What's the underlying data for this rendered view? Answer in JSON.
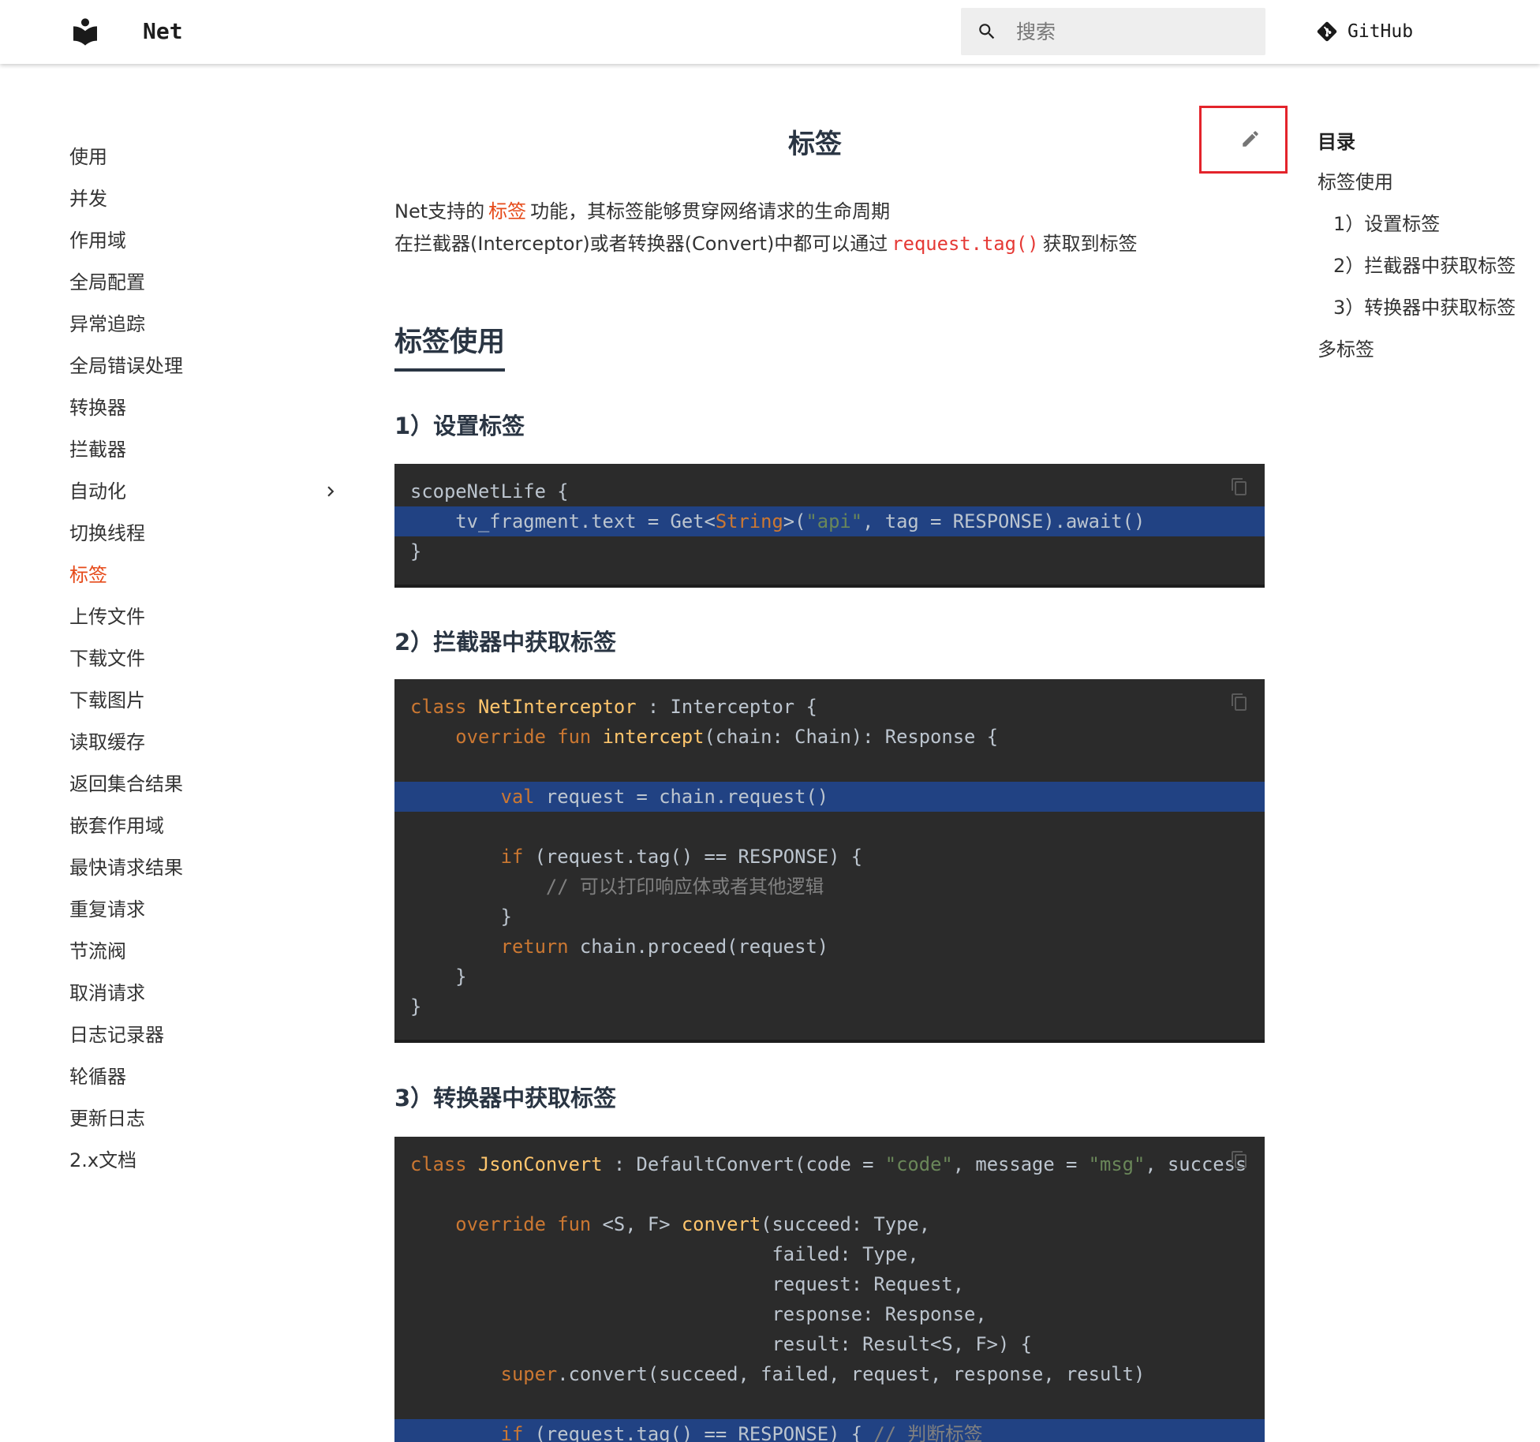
{
  "colors": {
    "accent": "#e64a19",
    "inline_code": "#e53935",
    "text": "#333333",
    "heading": "#2a3543",
    "code_bg": "#2b2b2b",
    "code_highlight": "#214283",
    "code_text": "#bcc5cf",
    "code_keyword": "#cc7832",
    "code_function": "#ffc66d",
    "code_string": "#6a8759",
    "code_comment": "#808080",
    "annotation_frame": "#e3242b"
  },
  "header": {
    "logo_icon": "book-reader-icon",
    "site_name": "Net",
    "search": {
      "icon": "search-icon",
      "placeholder": "搜索"
    },
    "github": {
      "icon": "git-icon",
      "label": "GitHub"
    }
  },
  "sidebar": {
    "items": [
      {
        "label": "使用"
      },
      {
        "label": "并发"
      },
      {
        "label": "作用域"
      },
      {
        "label": "全局配置"
      },
      {
        "label": "异常追踪"
      },
      {
        "label": "全局错误处理"
      },
      {
        "label": "转换器"
      },
      {
        "label": "拦截器"
      },
      {
        "label": "自动化",
        "expandable": true,
        "icon": "chevron-right-icon"
      },
      {
        "label": "切换线程"
      },
      {
        "label": "标签",
        "active": true
      },
      {
        "label": "上传文件"
      },
      {
        "label": "下载文件"
      },
      {
        "label": "下载图片"
      },
      {
        "label": "读取缓存"
      },
      {
        "label": "返回集合结果"
      },
      {
        "label": "嵌套作用域"
      },
      {
        "label": "最快请求结果"
      },
      {
        "label": "重复请求"
      },
      {
        "label": "节流阀"
      },
      {
        "label": "取消请求"
      },
      {
        "label": "日志记录器"
      },
      {
        "label": "轮循器"
      },
      {
        "label": "更新日志"
      },
      {
        "label": "2.x文档"
      }
    ]
  },
  "main": {
    "title": "标签",
    "edit_icon": "edit-icon",
    "intro": {
      "line1_before": "Net支持的",
      "line1_link": "标签",
      "line1_after": "功能，其标签能够贯穿网络请求的生命周期",
      "line2_before": "在拦截器(Interceptor)或者转换器(Convert)中都可以通过",
      "line2_code": "request.tag()",
      "line2_after": "获取到标签"
    },
    "section_heading": "标签使用",
    "copy_icon": "copy-icon",
    "subsections": [
      {
        "heading": "1）设置标签",
        "code": [
          {
            "tokens": [
              [
                "t",
                "scopeNetLife {"
              ]
            ]
          },
          {
            "highlight": true,
            "tokens": [
              [
                "t",
                "    tv_fragment.text = Get<"
              ],
              [
                "k",
                "String"
              ],
              [
                "t",
                ">("
              ],
              [
                "s",
                "\"api\""
              ],
              [
                "t",
                ", tag = RESPONSE).await()"
              ]
            ]
          },
          {
            "tokens": [
              [
                "t",
                "}"
              ]
            ]
          }
        ]
      },
      {
        "heading": "2）拦截器中获取标签",
        "code": [
          {
            "tokens": [
              [
                "k",
                "class"
              ],
              [
                "t",
                " "
              ],
              [
                "f",
                "NetInterceptor"
              ],
              [
                "t",
                " : Interceptor {"
              ]
            ]
          },
          {
            "tokens": [
              [
                "k",
                "    override fun"
              ],
              [
                "t",
                " "
              ],
              [
                "f",
                "intercept"
              ],
              [
                "t",
                "(chain: Chain): Response {"
              ]
            ]
          },
          {
            "tokens": []
          },
          {
            "highlight": true,
            "tokens": [
              [
                "k",
                "        val"
              ],
              [
                "t",
                " request = chain.request()"
              ]
            ]
          },
          {
            "tokens": []
          },
          {
            "tokens": [
              [
                "k",
                "        if"
              ],
              [
                "t",
                " (request.tag() == RESPONSE) {"
              ]
            ]
          },
          {
            "tokens": [
              [
                "c",
                "            // 可以打印响应体或者其他逻辑"
              ]
            ]
          },
          {
            "tokens": [
              [
                "t",
                "        }"
              ]
            ]
          },
          {
            "tokens": [
              [
                "k",
                "        return"
              ],
              [
                "t",
                " chain.proceed(request)"
              ]
            ]
          },
          {
            "tokens": [
              [
                "t",
                "    }"
              ]
            ]
          },
          {
            "tokens": [
              [
                "t",
                "}"
              ]
            ]
          }
        ]
      },
      {
        "heading": "3）转换器中获取标签",
        "code": [
          {
            "tokens": [
              [
                "k",
                "class"
              ],
              [
                "t",
                " "
              ],
              [
                "f",
                "JsonConvert"
              ],
              [
                "t",
                " : DefaultConvert(code = "
              ],
              [
                "s",
                "\"code\""
              ],
              [
                "t",
                ", message = "
              ],
              [
                "s",
                "\"msg\""
              ],
              [
                "t",
                ", success"
              ]
            ]
          },
          {
            "tokens": []
          },
          {
            "tokens": [
              [
                "k",
                "    override fun"
              ],
              [
                "t",
                " <S, F> "
              ],
              [
                "f",
                "convert"
              ],
              [
                "t",
                "(succeed: Type,"
              ]
            ]
          },
          {
            "tokens": [
              [
                "t",
                "                                failed: Type,"
              ]
            ]
          },
          {
            "tokens": [
              [
                "t",
                "                                request: Request,"
              ]
            ]
          },
          {
            "tokens": [
              [
                "t",
                "                                response: Response,"
              ]
            ]
          },
          {
            "tokens": [
              [
                "t",
                "                                result: Result<S, F>) {"
              ]
            ]
          },
          {
            "tokens": [
              [
                "k",
                "        super"
              ],
              [
                "t",
                ".convert(succeed, failed, request, response, result)"
              ]
            ]
          },
          {
            "tokens": []
          },
          {
            "highlight": true,
            "tokens": [
              [
                "k",
                "        if"
              ],
              [
                "t",
                " (request.tag() == RESPONSE) { "
              ],
              [
                "c",
                "// 判断标签"
              ]
            ]
          }
        ]
      }
    ]
  },
  "toc": {
    "title": "目录",
    "items": [
      {
        "label": "标签使用",
        "level": 1
      },
      {
        "label": "1）设置标签",
        "level": 2
      },
      {
        "label": "2）拦截器中获取标签",
        "level": 2
      },
      {
        "label": "3）转换器中获取标签",
        "level": 2
      },
      {
        "label": "多标签",
        "level": 1
      }
    ]
  }
}
